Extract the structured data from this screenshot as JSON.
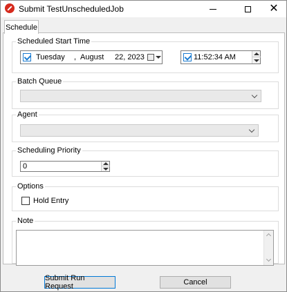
{
  "window": {
    "title": "Submit TestUnscheduledJob",
    "controls": [
      "minimize-icon",
      "maximize-icon",
      "close-icon"
    ]
  },
  "tabs": [
    {
      "label": "Schedule",
      "active": true
    }
  ],
  "scheduled_start": {
    "label": "Scheduled Start Time",
    "date": {
      "checked": true,
      "weekday": "Tuesday",
      "sep": ",",
      "month": "August",
      "day_year": "22, 2023"
    },
    "time": {
      "checked": true,
      "value": "11:52:34 AM"
    }
  },
  "batch_queue": {
    "label": "Batch Queue",
    "value": ""
  },
  "agent": {
    "label": "Agent",
    "value": ""
  },
  "scheduling_priority": {
    "label": "Scheduling Priority",
    "value": "0"
  },
  "options": {
    "label": "Options",
    "hold_entry": {
      "label": "Hold Entry",
      "checked": false
    }
  },
  "note": {
    "label": "Note",
    "value": ""
  },
  "buttons": {
    "submit": "Submit Run Request",
    "cancel": "Cancel"
  },
  "colors": {
    "accent": "#0078d7",
    "checkbox": "#1a7bd0",
    "app_icon": "#d62a1d"
  }
}
